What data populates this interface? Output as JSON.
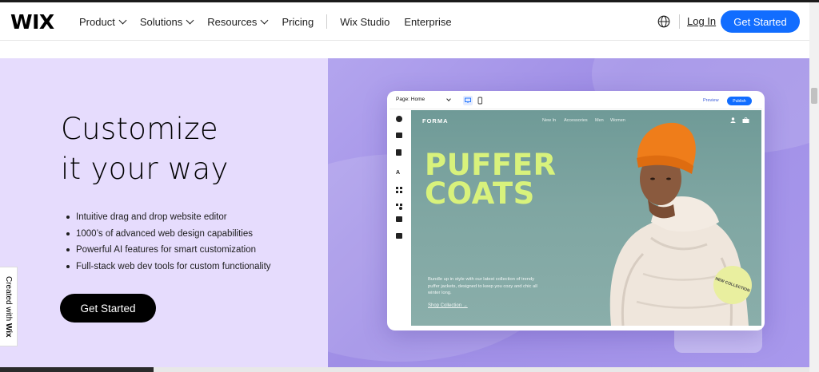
{
  "header": {
    "logo": "WIX",
    "nav": [
      {
        "label": "Product",
        "has_dropdown": true
      },
      {
        "label": "Solutions",
        "has_dropdown": true
      },
      {
        "label": "Resources",
        "has_dropdown": true
      },
      {
        "label": "Pricing",
        "has_dropdown": false
      }
    ],
    "nav_secondary": [
      {
        "label": "Wix Studio"
      },
      {
        "label": "Enterprise"
      }
    ],
    "globe_icon": "globe-icon",
    "login": "Log In",
    "cta": "Get Started"
  },
  "hero": {
    "title_line1": "Customize",
    "title_line2": "it your way",
    "bullets": [
      "Intuitive drag and drop website editor",
      "1000’s of advanced web design capabilities",
      "Powerful AI features for smart customization",
      "Full-stack web dev tools for custom functionality"
    ],
    "cta": "Get Started"
  },
  "created_with": {
    "prefix": "Created with ",
    "brand": "Wix"
  },
  "editor": {
    "page_select": "Page: Home",
    "preview": "Preview",
    "publish": "Publish",
    "tools": [
      "add-icon",
      "sections-icon",
      "pages-icon",
      "theme-icon",
      "apps-icon",
      "business-icon",
      "media-icon",
      "cms-icon"
    ],
    "site": {
      "brand": "FORMA",
      "nav": [
        "New In",
        "Accessories",
        "Men",
        "Women"
      ],
      "headline_line1": "PUFFER",
      "headline_line2": "COATS",
      "description": "Bundle up in style with our latest collection of trendy puffer jackets, designed to keep you cozy and chic all winter long.",
      "shop_link": "Shop Collection →",
      "badge": "NEW COLLECTION"
    }
  },
  "colors": {
    "accent": "#116dff",
    "hero_left_bg": "#e6dcfd",
    "hero_right_bg": "#a898ec",
    "headline": "#d8f27c"
  }
}
